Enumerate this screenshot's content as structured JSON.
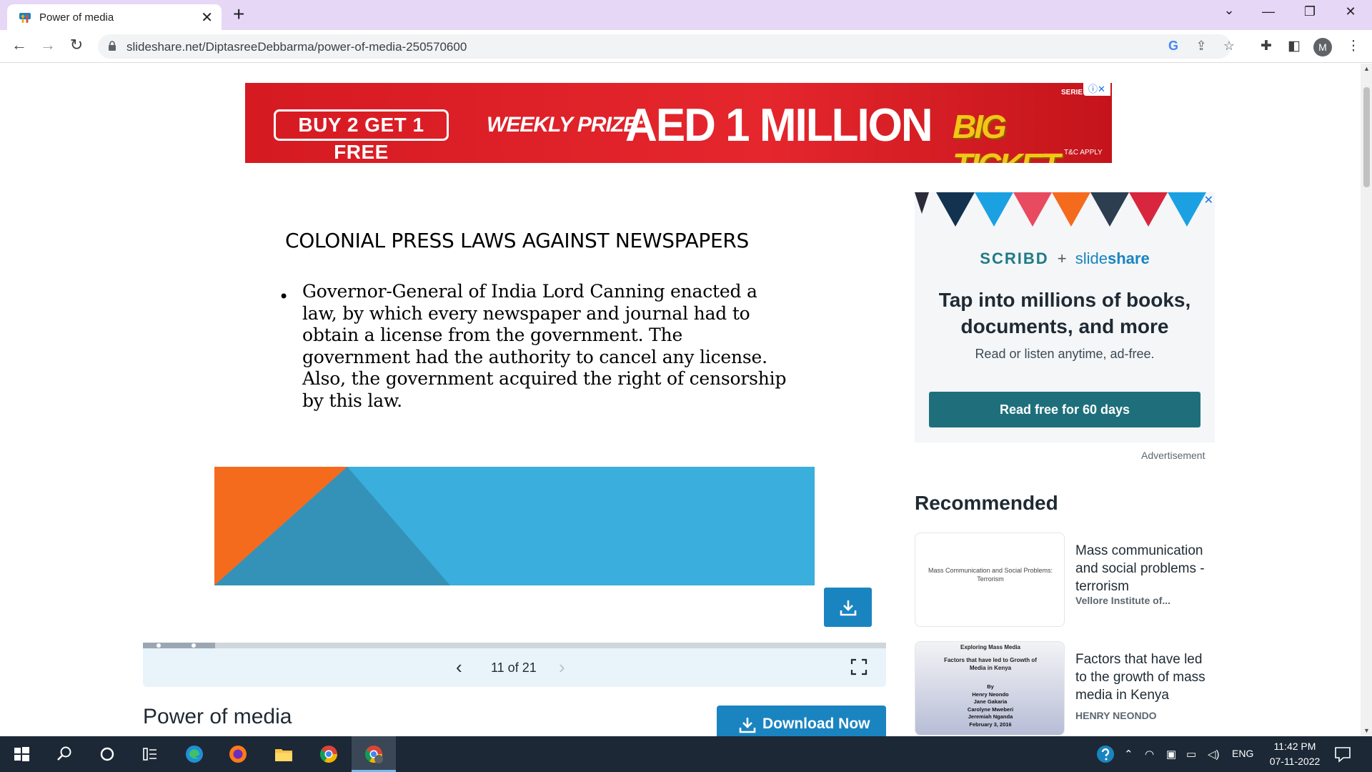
{
  "browser": {
    "tab_title": "Power of media",
    "url": "slideshare.net/DiptasreeDebbarma/power-of-media-250570600",
    "profile_initial": "M"
  },
  "top_ad": {
    "offer": "BUY 2 GET 1 FREE",
    "prize_label": "WEEKLY PRIZE:",
    "prize_value": "AED 1 MILLION",
    "brand": "BIG TICKET",
    "series": "SERIE",
    "tnc": "T&C APPLY"
  },
  "slide": {
    "heading": "COLONIAL PRESS LAWS AGAINST NEWSPAPERS",
    "bullet": "•",
    "body": "Governor-General of India Lord Canning enacted a law, by which every newspaper and journal had to obtain a license from the government. The government had the authority to cancel any license. Also, the government acquired the right of censorship by this law.",
    "current_page": 11,
    "total_pages": 21,
    "counter": "11 of 21"
  },
  "document": {
    "title": "Power of media",
    "download_label": "Download Now"
  },
  "side_ad": {
    "brand_a": "SCRIBD",
    "plus": "+",
    "brand_b_light": "slide",
    "brand_b_bold": "share",
    "headline": "Tap into millions of books, documents, and more",
    "sub": "Read or listen anytime, ad-free.",
    "cta": "Read free for 60 days",
    "ad_label": "Advertisement"
  },
  "recommended": {
    "title": "Recommended",
    "items": [
      {
        "title": "Mass communication and social problems - terrorism",
        "author": "Vellore Institute of...",
        "thumb_text": "Mass Communication and Social Problems: Terrorism"
      },
      {
        "title": "Factors that have led to the growth of mass media in Kenya",
        "author": "HENRY NEONDO",
        "thumb_title": "Exploring Mass Media",
        "thumb_sub": "Factors that have led to Growth of Media in Kenya",
        "thumb_authors": "By\nHenry Neondo\nJane Gakaria\nCarolyne Mweberi\nJeremiah Nganda\nFebruary 3, 2016"
      }
    ]
  },
  "taskbar": {
    "language": "ENG",
    "time": "11:42 PM",
    "date": "07-11-2022"
  },
  "colors": {
    "accent": "#1a84c0",
    "cta": "#1e6f7b",
    "tabbar": "#e6d7f7",
    "ad_red": "#e5262d"
  }
}
